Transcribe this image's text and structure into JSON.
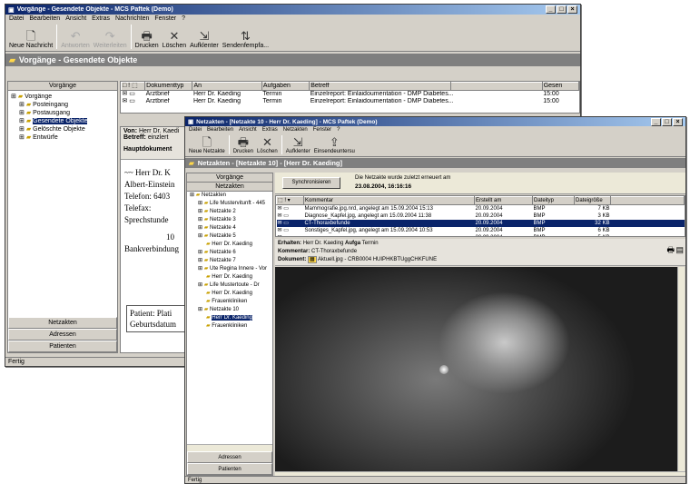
{
  "back": {
    "title": "Vorgänge - Gesendete Objekte - MCS Paftek (Demo)",
    "menu": [
      "Datei",
      "Bearbeiten",
      "Ansicht",
      "Extras",
      "Nachrichten",
      "Fenster",
      "?"
    ],
    "toolbar": [
      {
        "label": "Neue Nachricht",
        "icon": "new-message-icon",
        "disabled": false
      },
      {
        "label": "Antworten",
        "icon": "reply-icon",
        "disabled": true
      },
      {
        "label": "Weiterleiten",
        "icon": "forward-icon",
        "disabled": true
      },
      {
        "label": "Drucken",
        "icon": "print-icon",
        "disabled": false
      },
      {
        "label": "Löschen",
        "icon": "delete-icon",
        "disabled": false
      },
      {
        "label": "Aufklenter",
        "icon": "archive-icon",
        "disabled": false
      },
      {
        "label": "Sendenfempfa...",
        "icon": "send-receive-icon",
        "disabled": false
      }
    ],
    "band_title": "Vorgänge - Gesendete Objekte",
    "tree_header": "Vorgänge",
    "tree": [
      {
        "label": "Vorgänge",
        "level": 0,
        "selected": false
      },
      {
        "label": "Posteingang",
        "level": 1,
        "selected": false
      },
      {
        "label": "Postausgang",
        "level": 1,
        "selected": false
      },
      {
        "label": "Gesendete Objekte",
        "level": 1,
        "selected": true
      },
      {
        "label": "Gelöschte Objekte",
        "level": 1,
        "selected": false
      },
      {
        "label": "Entwürfe",
        "level": 1,
        "selected": false
      }
    ],
    "nav_buttons": [
      "Netzakten",
      "Adressen",
      "Patienten"
    ],
    "list_headers": [
      "!",
      "Dokumenttyp",
      "An",
      "Aufgaben",
      "Betreff",
      "Gesen"
    ],
    "list_rows": [
      {
        "doctype": "Arztbrief",
        "to": "Herr Dr. Kaeding",
        "task": "Termin",
        "subject": "Einzelreport: Einlaidoumentation - DMP Diabetes...",
        "sent": "15:00"
      },
      {
        "doctype": "Arztbrief",
        "to": "Herr Dr. Kaeding",
        "task": "Termin",
        "subject": "Einzelreport: Einlaidoumentation - DMP Diabetes...",
        "sent": "15:00"
      }
    ],
    "preview": {
      "from_label": "Von:",
      "from_value": "Herr Dr. Kaedi",
      "subject_label": "Betreff:",
      "subject_value": "einzlert",
      "main_label": "Hauptdokument",
      "doc_lines": [
        "~~ Herr Dr. K",
        "Albert-Einstein",
        "Telefon: 6403",
        "Telefax:",
        "Sprechstunde",
        "10",
        "Bankverbindung"
      ],
      "box_lines": [
        "Patient: Plati",
        "Geburtsdatum"
      ]
    },
    "status": "Fertig"
  },
  "front": {
    "title": "Netzakten - [Netzakte 10 - Herr Dr. Kaeding] - MCS Paftek (Demo)",
    "menu": [
      "Datei",
      "Bearbeiten",
      "Ansicht",
      "Extras",
      "Netzakten",
      "Fenster",
      "?"
    ],
    "toolbar": [
      {
        "label": "Neue Netzakte",
        "icon": "new-netfile-icon"
      },
      {
        "label": "Drucken",
        "icon": "print-icon"
      },
      {
        "label": "Löschen",
        "icon": "delete-icon"
      },
      {
        "label": "Aufklenter",
        "icon": "archive-icon"
      },
      {
        "label": "Einsendeuntersu",
        "icon": "send-icon"
      }
    ],
    "band_title": "Netzakten - [Netzakte 10] - [Herr Dr. Kaeding]",
    "tree_header": "Vorgänge",
    "tree_subheader": "Netzakten",
    "tree": [
      {
        "label": "Netzakten",
        "level": 0,
        "selected": false
      },
      {
        "label": "Life Mustervitunft - 445",
        "level": 1,
        "selected": false
      },
      {
        "label": "Netzakte 2",
        "level": 1,
        "selected": false
      },
      {
        "label": "Netzakte 3",
        "level": 1,
        "selected": false
      },
      {
        "label": "Netzakte 4",
        "level": 1,
        "selected": false
      },
      {
        "label": "Netzakte 5",
        "level": 1,
        "selected": false
      },
      {
        "label": "Herr Dr. Kaeding",
        "level": 2,
        "selected": false
      },
      {
        "label": "Netzakte 6",
        "level": 1,
        "selected": false
      },
      {
        "label": "Netzakte 7",
        "level": 1,
        "selected": false
      },
      {
        "label": "Ute Regina Innere - Vor",
        "level": 1,
        "selected": false
      },
      {
        "label": "Herr Dr. Kaeding",
        "level": 2,
        "selected": false
      },
      {
        "label": "Life Mustertoute - Dr",
        "level": 1,
        "selected": false
      },
      {
        "label": "Herr Dr. Kaeding",
        "level": 2,
        "selected": false
      },
      {
        "label": "Frauenkliniken",
        "level": 2,
        "selected": false
      },
      {
        "label": "Netzakte 10",
        "level": 1,
        "selected": false
      },
      {
        "label": "Herr Dr. Kaeding",
        "level": 2,
        "selected": true
      },
      {
        "label": "Frauenkliniken",
        "level": 2,
        "selected": false
      }
    ],
    "nav_buttons": [
      "Adressen",
      "Patienten"
    ],
    "sync_button": "Synchronisieren",
    "sync_note": "Die Netzakte wurde zuletzt erneuert am",
    "sync_date": "23.08.2004, 16:16:16",
    "list_headers": [
      "!",
      "Kommentar",
      "Erstellt am",
      "Dateityp",
      "Dateigröße"
    ],
    "list_rows": [
      {
        "comment": "Mammografie.jpg.nrd, angelegt am 15.09.2004 15:13",
        "created": "20.09.2004",
        "type": "BMP",
        "size": "7 KB",
        "selected": false
      },
      {
        "comment": "Diagnose_Kapfel.jpg, angelegt am 15.09.2004 11:38",
        "created": "20.09.2004",
        "type": "BMP",
        "size": "3 KB",
        "selected": false
      },
      {
        "comment": "CT-Thoraxbefunde",
        "created": "20.09.2004",
        "type": "BMP",
        "size": "32 KB",
        "selected": true
      },
      {
        "comment": "Sonstiges_Kapfel.jpg, angelegt am 15.09.2004 10:53",
        "created": "20.09.2004",
        "type": "BMP",
        "size": "6 KB",
        "selected": false
      },
      {
        "comment": "",
        "created": "20.09.2004",
        "type": "BMP",
        "size": "5 KB",
        "selected": false
      }
    ],
    "detail": {
      "from_label": "Erhalten:",
      "from_value": "Herr Dr. Kaeding",
      "task_label": "Aufga",
      "task_value": "Termin",
      "comment_label": "Kommentar:",
      "comment_value": "CT-Thoraxbefunde",
      "doc_label": "Dokument:",
      "doc_value": "Aktuell.jpg - CRB0004 HUIPHKBTUggCHKFUNE"
    },
    "status": "Fertig"
  }
}
